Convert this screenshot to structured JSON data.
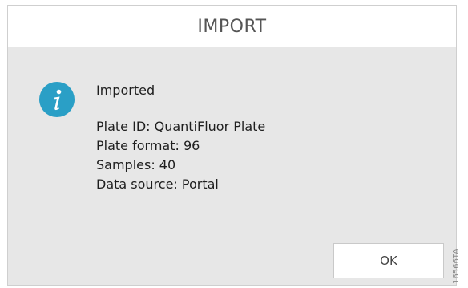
{
  "dialog": {
    "title": "IMPORT",
    "icon": "info-icon",
    "icon_color": "#2a9fc6",
    "message": {
      "heading": "Imported",
      "lines": [
        "Plate ID: QuantiFluor Plate",
        "Plate format: 96",
        "Samples: 40",
        "Data source: Portal"
      ]
    },
    "ok_label": "OK"
  },
  "figure_code": "16566TA"
}
